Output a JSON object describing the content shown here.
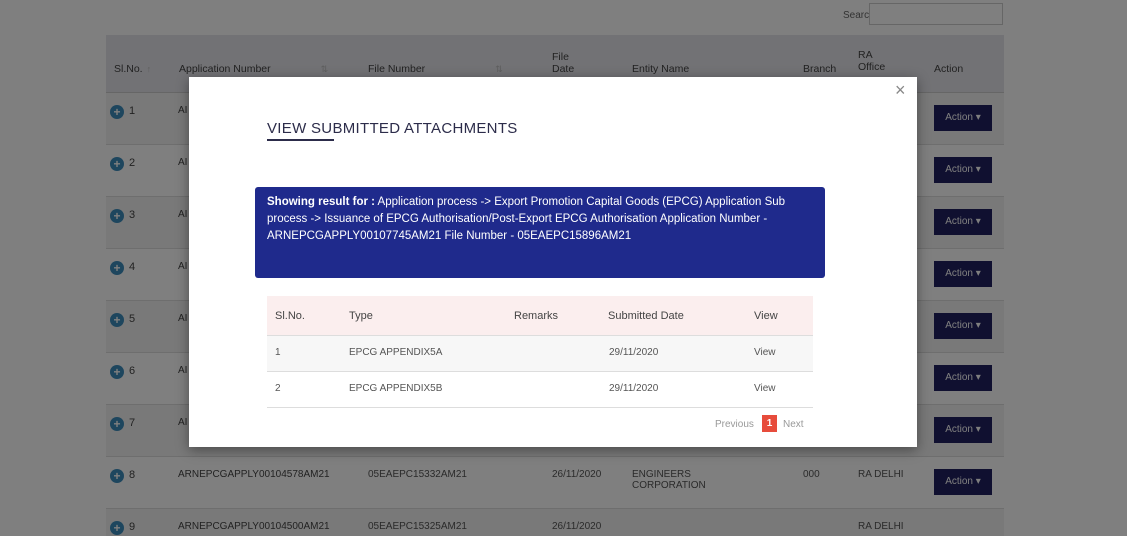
{
  "background": {
    "search_label": "Search:",
    "headers": {
      "sl_no": "Sl.No.",
      "application_number": "Application Number",
      "file_number": "File Number",
      "file_date": "File Date",
      "entity_name": "Entity Name",
      "branch": "Branch",
      "ra_office": "RA Office",
      "action": "Action"
    },
    "rows": [
      {
        "sl": "1",
        "app": "AI",
        "action": "Action ▾"
      },
      {
        "sl": "2",
        "app": "AI",
        "action": "Action ▾"
      },
      {
        "sl": "3",
        "app": "AI",
        "action": "Action ▾"
      },
      {
        "sl": "4",
        "app": "AI",
        "action": "Action ▾"
      },
      {
        "sl": "5",
        "app": "AI",
        "action": "Action ▾"
      },
      {
        "sl": "6",
        "app": "AI",
        "action": "Action ▾"
      },
      {
        "sl": "7",
        "app": "AI",
        "action": "Action ▾"
      },
      {
        "sl": "8",
        "app": "ARNEPCGAPPLY00104578AM21",
        "file": "05EAEPC15332AM21",
        "date": "26/11/2020",
        "entity": "ENGINEERS CORPORATION",
        "branch": "000",
        "ra": "RA DELHI",
        "action": "Action ▾"
      },
      {
        "sl": "9",
        "app": "ARNEPCGAPPLY00104500AM21",
        "file": "05EAEPC15325AM21",
        "date": "26/11/2020",
        "entity": "",
        "branch": "",
        "ra": "RA DELHI",
        "action": ""
      }
    ]
  },
  "modal": {
    "title": "VIEW SUBMITTED ATTACHMENTS",
    "close_glyph": "×",
    "info_bold": "Showing result for :",
    "info_text": " Application process -> Export Promotion Capital Goods (EPCG) Application Sub process -> Issuance of EPCG Authorisation/Post-Export EPCG Authorisation Application Number - ARNEPCGAPPLY00107745AM21 File Number - 05EAEPC15896AM21",
    "table": {
      "headers": {
        "sl": "Sl.No.",
        "type": "Type",
        "remarks": "Remarks",
        "date": "Submitted Date",
        "view": "View"
      },
      "rows": [
        {
          "sl": "1",
          "type": "EPCG APPENDIX5A",
          "remarks": "",
          "date": "29/11/2020",
          "view": "View"
        },
        {
          "sl": "2",
          "type": "EPCG APPENDIX5B",
          "remarks": "",
          "date": "29/11/2020",
          "view": "View"
        }
      ]
    },
    "pagination": {
      "previous": "Previous",
      "current": "1",
      "next": "Next"
    }
  },
  "colors": {
    "action_button": "#202060",
    "info_banner": "#1f2a8c",
    "page_active": "#e74c3c",
    "link": "#337ab7"
  }
}
